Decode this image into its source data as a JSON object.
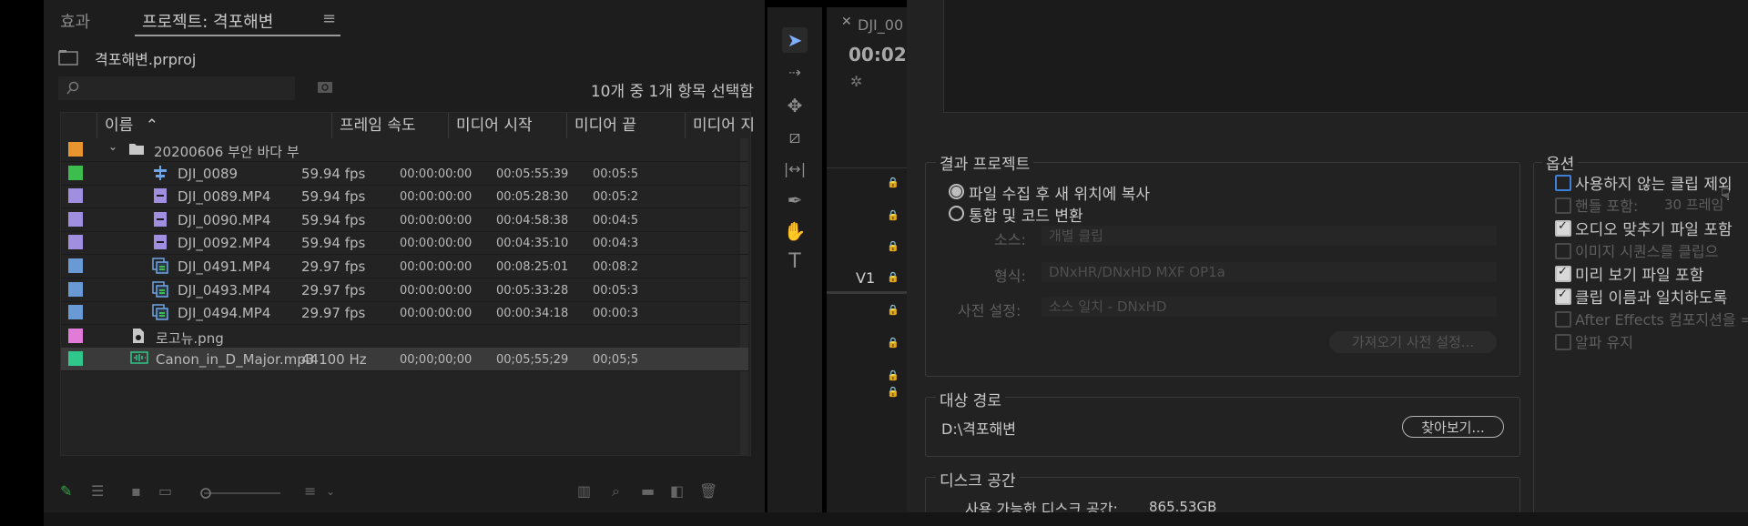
{
  "project_panel": {
    "tabs": {
      "effects": "효과",
      "project": "프로젝트: 격포해변"
    },
    "project_file": "격포해변.prproj",
    "selection_count": "10개 중 1개 항목 선택함",
    "columns": {
      "name": "이름",
      "frame_rate": "프레임 속도",
      "media_start": "미디어 시작",
      "media_end": "미디어 끝",
      "media_dur": "미디어 지"
    },
    "rows": [
      {
        "name": "20200606 부안 바다 부",
        "fps": "",
        "start": "",
        "end": "",
        "dur": "",
        "color": "#e8952d",
        "icon": "folder-icon"
      },
      {
        "name": "DJI_0089",
        "fps": "59.94 fps",
        "start": "00:00:00:00",
        "end": "00:05:55:39",
        "dur": "00:05:5",
        "color": "#3dbd4e",
        "icon": "sequence-icon"
      },
      {
        "name": "DJI_0089.MP4",
        "fps": "59.94 fps",
        "start": "00:00:00:00",
        "end": "00:05:28:30",
        "dur": "00:05:2",
        "color": "#a08ee0",
        "icon": "video-clip-icon"
      },
      {
        "name": "DJI_0090.MP4",
        "fps": "59.94 fps",
        "start": "00:00:00:00",
        "end": "00:04:58:38",
        "dur": "00:04:5",
        "color": "#a08ee0",
        "icon": "video-clip-icon"
      },
      {
        "name": "DJI_0092.MP4",
        "fps": "59.94 fps",
        "start": "00:00:00:00",
        "end": "00:04:35:10",
        "dur": "00:04:3",
        "color": "#a08ee0",
        "icon": "video-clip-icon"
      },
      {
        "name": "DJI_0491.MP4",
        "fps": "29.97 fps",
        "start": "00:00:00:00",
        "end": "00:08:25:01",
        "dur": "00:08:2",
        "color": "#6a9ad6",
        "icon": "av-clip-icon"
      },
      {
        "name": "DJI_0493.MP4",
        "fps": "29.97 fps",
        "start": "00:00:00:00",
        "end": "00:05:33:28",
        "dur": "00:05:3",
        "color": "#6a9ad6",
        "icon": "av-clip-icon"
      },
      {
        "name": "DJI_0494.MP4",
        "fps": "29.97 fps",
        "start": "00:00:00:00",
        "end": "00:00:34:18",
        "dur": "00:00:3",
        "color": "#6a9ad6",
        "icon": "av-clip-icon"
      },
      {
        "name": "로고뉴.png",
        "fps": "",
        "start": "",
        "end": "",
        "dur": "",
        "color": "#e27ad7",
        "icon": "image-file-icon"
      },
      {
        "name": "Canon_in_D_Major.mp3",
        "fps": "44100 Hz",
        "start": "00;00;00;00",
        "end": "00;05;55;29",
        "dur": "00;05;5",
        "color": "#2fc78b",
        "icon": "audio-clip-icon"
      }
    ]
  },
  "timeline": {
    "tab": "DJI_00",
    "timecode": "00:02:",
    "track": "V1"
  },
  "dialog": {
    "result_project": {
      "title": "결과 프로젝트",
      "option_copy": "파일 수집 후 새 위치에 복사",
      "option_consolidate": "통합 및 코드 변환",
      "source_label": "소스:",
      "source_value": "개별 클립",
      "format_label": "형식:",
      "format_value": "DNxHR/DNxHD MXF OP1a",
      "preset_label": "사전 설정:",
      "preset_value": "소스 일치 - DNxHD",
      "import_preset_button": "가져오기 사전 설정..."
    },
    "destination": {
      "title": "대상 경로",
      "path": "D:\\격포해변",
      "browse_button": "찾아보기..."
    },
    "disk_space": {
      "title": "디스크 공간",
      "label": "사용 가능한 디스크 공간:",
      "value": "865.53GB"
    },
    "options": {
      "title": "옵션",
      "items": [
        {
          "label": "사용하지 않는 클립 제외",
          "checked": false,
          "enabled": true
        },
        {
          "label": "핸들 포함:",
          "extra": "30 프레임",
          "checked": false,
          "enabled": false
        },
        {
          "label": "오디오 맞추기 파일 포함",
          "checked": true,
          "enabled": true
        },
        {
          "label": "이미지 시퀀스를 클립으",
          "checked": false,
          "enabled": false
        },
        {
          "label": "미리 보기 파일 포함",
          "checked": true,
          "enabled": true
        },
        {
          "label": "클립 이름과 일치하도록",
          "checked": true,
          "enabled": true
        },
        {
          "label": "After Effects 컴포지션을 =",
          "checked": false,
          "enabled": false
        },
        {
          "label": "알파 유지",
          "checked": false,
          "enabled": false
        }
      ]
    }
  }
}
